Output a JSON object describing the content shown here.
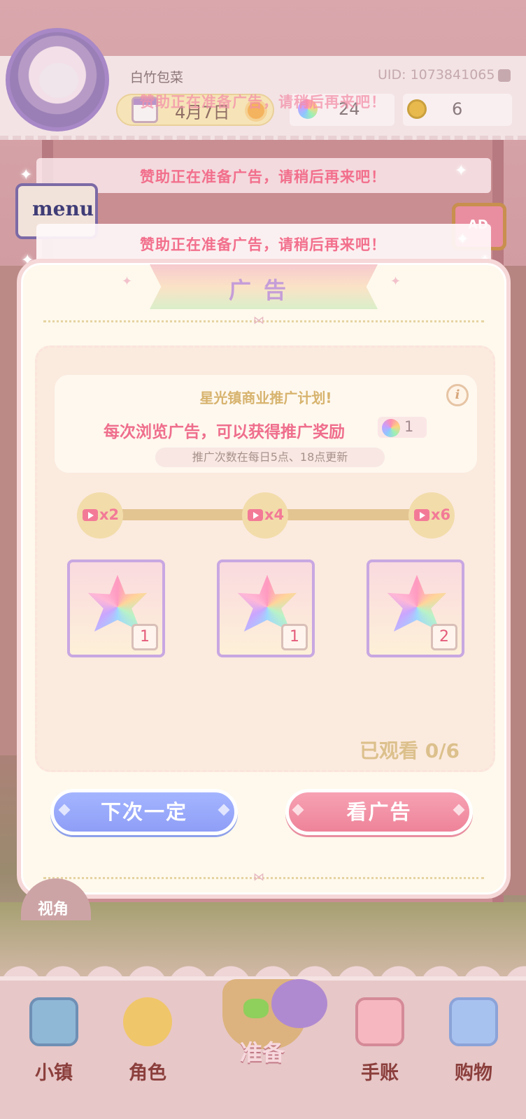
{
  "header": {
    "nickname": "白竹包菜",
    "uid": "UID: 1073841065",
    "date": "4月7日",
    "gems": "24",
    "coins": "6"
  },
  "toasts": {
    "faded": "赞助正在准备广告，请稍后再来吧！",
    "first": "赞助正在准备广告，请稍后再来吧！",
    "second": "赞助正在准备广告，请稍后再来吧！"
  },
  "side": {
    "menu_label": "menu",
    "ad_label": "AD"
  },
  "modal": {
    "title": "广告",
    "plan_title": "星光镇商业推广计划!",
    "info_icon": "i",
    "description": "每次浏览广告，可以获得推广奖励",
    "reward_per_view": "1",
    "refresh_note": "推广次数在每日5点、18点更新",
    "milestones": [
      {
        "label": "x2"
      },
      {
        "label": "x4"
      },
      {
        "label": "x6"
      }
    ],
    "rewards": [
      {
        "count": "1",
        "icon": "rainbow-gem-icon"
      },
      {
        "count": "1",
        "icon": "rainbow-gem-icon"
      },
      {
        "count": "2",
        "icon": "rainbow-gem-icon"
      }
    ],
    "watched_text": "已观看 0/6",
    "later_button": "下次一定",
    "watch_button": "看广告"
  },
  "view_button": "视角",
  "nav": {
    "town": "小镇",
    "character": "角色",
    "prepare": "准备",
    "journal": "手账",
    "shop": "购物"
  },
  "colors": {
    "accent_pink": "#ef6e8c",
    "button_blue": "#8f9ef6",
    "button_pink": "#ee8399",
    "gold_text": "#dcc08c",
    "modal_bg": "#fef9ec"
  }
}
